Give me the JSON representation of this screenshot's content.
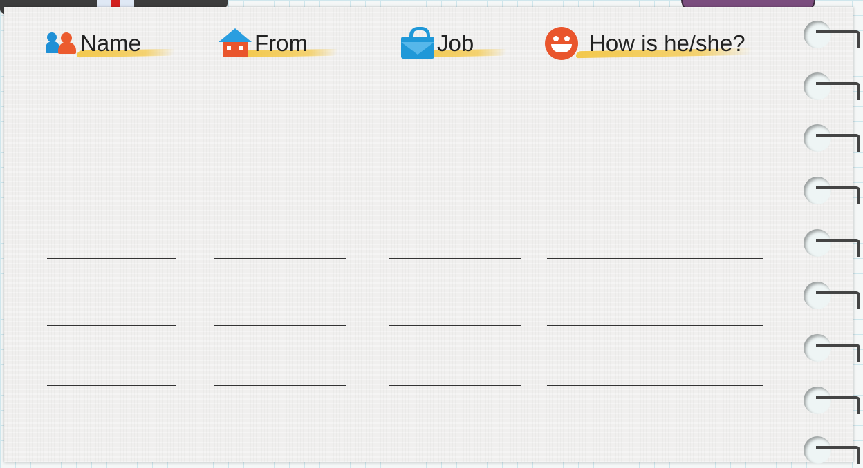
{
  "columns": [
    {
      "label": "Name",
      "icon": "people-icon"
    },
    {
      "label": "From",
      "icon": "house-icon"
    },
    {
      "label": "Job",
      "icon": "briefcase-icon"
    },
    {
      "label": "How is he/she?",
      "icon": "smiley-face-icon"
    }
  ],
  "colors": {
    "accent_blue": "#1f90d6",
    "accent_orange": "#e9552c",
    "highlight_yellow": "#f3c43b"
  }
}
